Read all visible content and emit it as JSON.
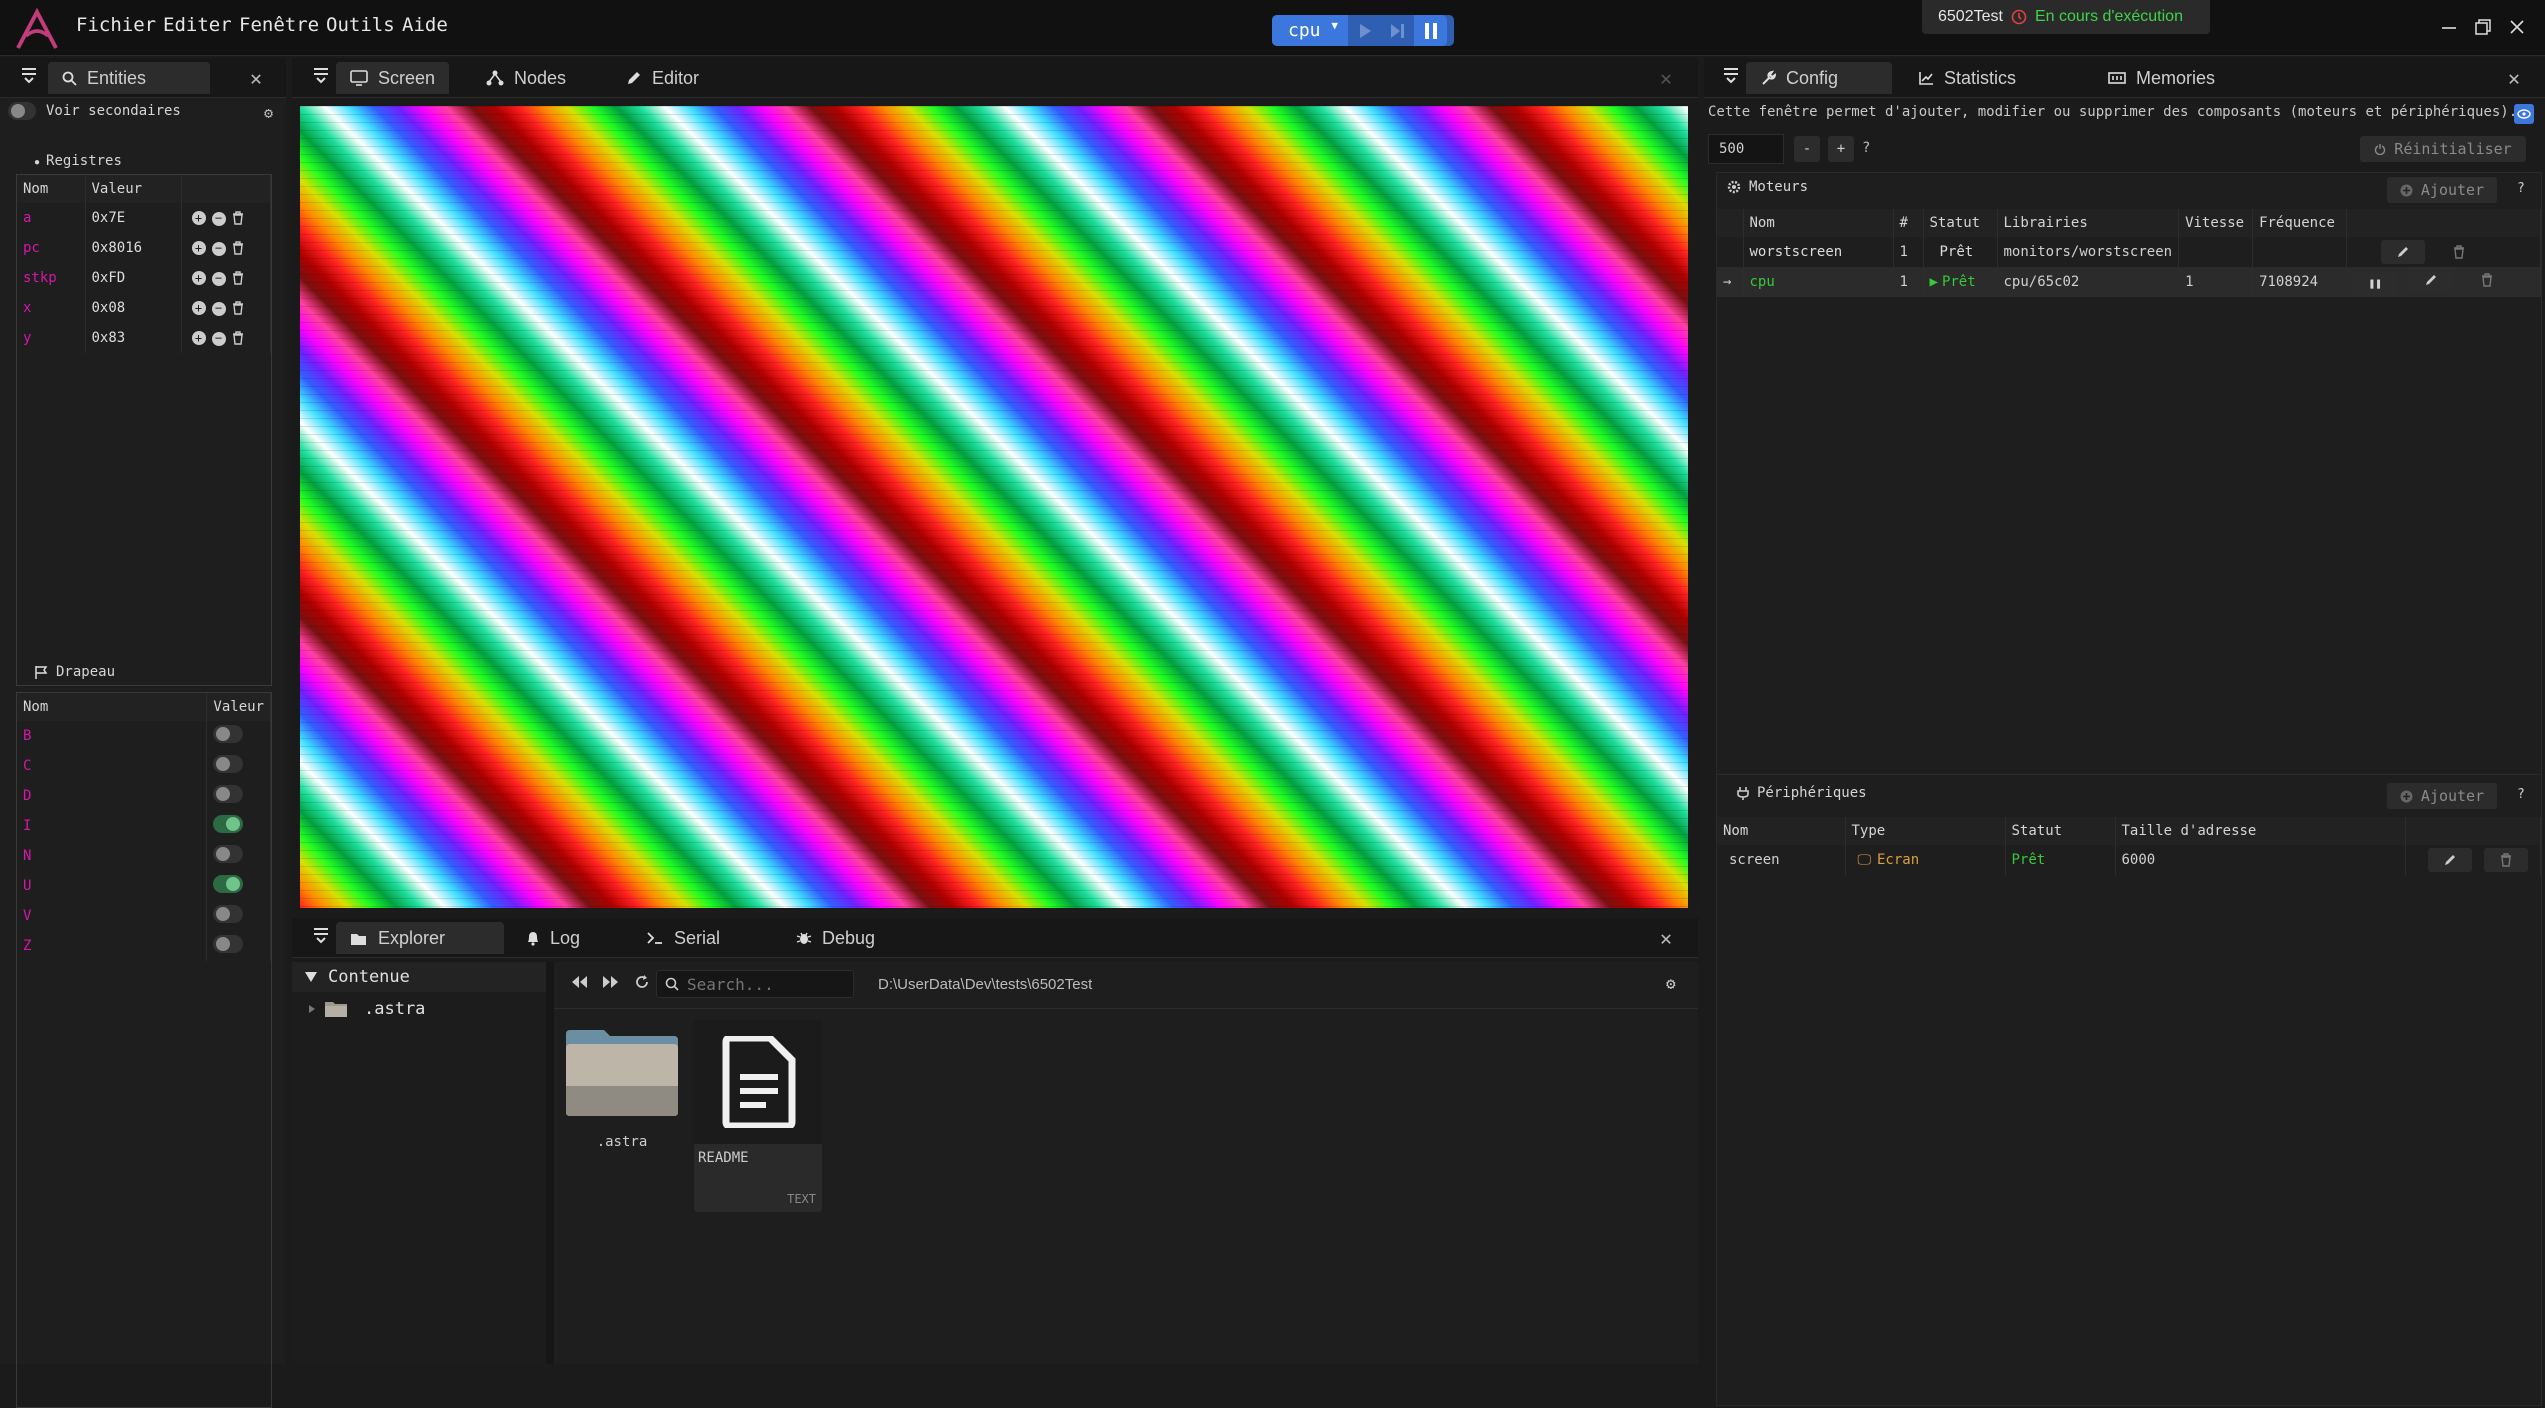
{
  "menu": {
    "file": "Fichier",
    "edit": "Editer",
    "window": "Fenêtre",
    "tools": "Outils",
    "help": "Aide"
  },
  "toolbar": {
    "cpu_select": "cpu"
  },
  "run_state": {
    "project": "6502Test",
    "status": "En cours d'exécution"
  },
  "left_panel": {
    "tab": "Entities",
    "show_secondary": "Voir secondaires",
    "registers": {
      "title": "Registres",
      "col_name": "Nom",
      "col_value": "Valeur",
      "rows": [
        {
          "name": "a",
          "value": "0x7E"
        },
        {
          "name": "pc",
          "value": "0x8016"
        },
        {
          "name": "stkp",
          "value": "0xFD"
        },
        {
          "name": "x",
          "value": "0x08"
        },
        {
          "name": "y",
          "value": "0x83"
        }
      ]
    },
    "flags": {
      "title": "Drapeau",
      "col_name": "Nom",
      "col_value": "Valeur",
      "rows": [
        {
          "name": "B",
          "on": false
        },
        {
          "name": "C",
          "on": false
        },
        {
          "name": "D",
          "on": false
        },
        {
          "name": "I",
          "on": true
        },
        {
          "name": "N",
          "on": false
        },
        {
          "name": "U",
          "on": true
        },
        {
          "name": "V",
          "on": false
        },
        {
          "name": "Z",
          "on": false
        }
      ]
    }
  },
  "center_tabs": {
    "screen": "Screen",
    "nodes": "Nodes",
    "editor": "Editor"
  },
  "bottom_tabs": {
    "explorer": "Explorer",
    "log": "Log",
    "serial": "Serial",
    "debug": "Debug"
  },
  "explorer": {
    "tree_root": "Contenue",
    "tree_items": [
      ".astra"
    ],
    "search_placeholder": "Search...",
    "path": "D:\\UserData\\Dev\\tests\\6502Test",
    "files": [
      {
        "name": ".astra",
        "kind": "folder"
      },
      {
        "name": "README",
        "kind": "text",
        "tag": "TEXT"
      }
    ]
  },
  "right_tabs": {
    "config": "Config",
    "statistics": "Statistics",
    "memories": "Memories"
  },
  "config": {
    "description": "Cette fenêtre permet d'ajouter, modifier ou supprimer des composants (moteurs et périphériques).",
    "speed_value": "500",
    "minus": "-",
    "plus": "+",
    "reset": "Réinitialiser",
    "engines": {
      "title": "Moteurs",
      "add": "Ajouter",
      "headers": {
        "name": "Nom",
        "count": "#",
        "status": "Statut",
        "libs": "Librairies",
        "speed": "Vitesse",
        "freq": "Fréquence"
      },
      "rows": [
        {
          "name": "worstscreen",
          "count": "1",
          "status": "Prêt",
          "libs": "monitors/worstscreen",
          "speed": "",
          "freq": "",
          "selected": false,
          "running": false
        },
        {
          "name": "cpu",
          "count": "1",
          "status": "Prêt",
          "libs": "cpu/65c02",
          "speed": "1",
          "freq": "7108924",
          "selected": true,
          "running": true
        }
      ]
    },
    "peripherals": {
      "title": "Périphériques",
      "add": "Ajouter",
      "headers": {
        "name": "Nom",
        "type": "Type",
        "status": "Statut",
        "addr": "Taille d'adresse"
      },
      "rows": [
        {
          "name": "screen",
          "type": "Ecran",
          "status": "Prêt",
          "addr": "6000"
        }
      ]
    }
  },
  "colors": {
    "accent": "#3b77dc",
    "pink": "#d418a8",
    "green": "#36c93a",
    "orange": "#d9a03a"
  }
}
